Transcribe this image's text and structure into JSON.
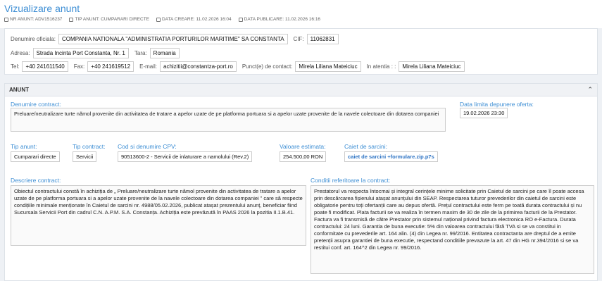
{
  "page": {
    "title": "Vizualizare anunt",
    "meta": [
      {
        "label": "NR ANUNT: ADV1516237",
        "icon": "tag-icon"
      },
      {
        "label": "TIP ANUNT: CUMPARARI DIRECTE",
        "icon": "tag-icon"
      },
      {
        "label": "DATA CREARE: 11.02.2026 16:04",
        "icon": "calendar-icon"
      },
      {
        "label": "DATA PUBLICARE: 11.02.2026 16:16",
        "icon": "calendar-icon"
      }
    ]
  },
  "authority": {
    "name_label": "Denumire oficiala:",
    "name": "COMPANIA NATIONALA \"ADMINISTRATIA PORTURILOR MARITIME\" SA CONSTANTA",
    "cif_label": "CIF:",
    "cif": "11062831",
    "address_label": "Adresa:",
    "address": "Strada Incinta Port Constanta, Nr. 1",
    "country_label": "Tara:",
    "country": "Romania",
    "tel_label": "Tel:",
    "tel": "+40 241611540",
    "fax_label": "Fax:",
    "fax": "+40 241619512",
    "email_label": "E-mail:",
    "email": "achizitii@constantza-port.ro",
    "contact_label": "Punct(e) de contact:",
    "contact": "Mirela Liliana Mateiciuc",
    "attention_label": "In atentia : :",
    "attention": "Mirela Liliana Mateiciuc"
  },
  "anunt": {
    "section_title": "ANUNT",
    "contract_name_label": "Denumire contract:",
    "contract_name": "Preluare/neutralizare turte nămol provenite din activitatea de tratare a apelor uzate de pe platforma portuara si a apelor uzate provenite de la navele colectoare din dotarea companiei",
    "deadline_label": "Data limita depunere oferta:",
    "deadline": "19.02.2026 23:30",
    "tip_anunt_label": "Tip anunt:",
    "tip_anunt": "Cumparari directe",
    "tip_contract_label": "Tip contract:",
    "tip_contract": "Servicii",
    "cpv_label": "Cod si denumire CPV:",
    "cpv": "90513600-2 - Servicii de inlaturare a namolului (Rev.2)",
    "value_label": "Valoare estimata:",
    "value": "254.500,00",
    "currency": "RON",
    "caiet_label": "Caiet de sarcini:",
    "caiet": "caiet de sarcini +formulare.zip.p7s",
    "description_label": "Descriere contract:",
    "description": "Obiectul contractului constă în achiziția de „ Preluare/neutralizare turte nămol provenite din activitatea de tratare a apelor uzate de pe platforma portuara si a apelor uzate provenite de la navele colectoare din dotarea companiei ” care să respecte condițiile minimale menționate în Caietul de sarcini nr. 4988/05.02.2026, publicat atașat prezentului anunț, beneficiar fiind Sucursala Servicii Port din cadrul C.N. A.P.M. S.A. Constanța. Achiziția este prevăzută în PAAS 2026 la pozitia II.1.B.41.",
    "conditions_label": "Conditii referitoare la contract:",
    "conditions": "Prestatorul va respecta întocmai și integral cerințele minime solicitate prin Caietul de sarcini pe care îl poate accesa prin descărcarea fișierului atașat anunțului din SEAP. Respectarea tuturor prevederilor din caietul de sarcini este obligatorie pentru toți ofertanții care au depus ofertă. Prețul contractului este ferm pe toată durata contractului și nu poate fi modificat. Plata facturii se va realiza în termen maxim de 30 de zile de la primirea facturii de la Prestator. Factura va fi transmisă de către Prestator prin sistemul național privind factura electronica RO e-Factura. Durata contractului: 24 luni. Garantia de buna executie: 5% din valoarea contractului fără TVA si se va constitui in conformitate cu prevederile art. 164 alin. (4) din Legea nr. 99/2016. Entitatea contractanta are dreptul de a emite pretenții asupra garantiei de buna executie, respectand conditiile prevazute la art. 47 din HG nr.394/2016 si se va restitui conf. art. 164^2 din Legea nr. 99/2016."
  },
  "colors": {
    "accent": "#3d8ed4",
    "link": "#2e74c4",
    "background": "#eef1f5"
  }
}
